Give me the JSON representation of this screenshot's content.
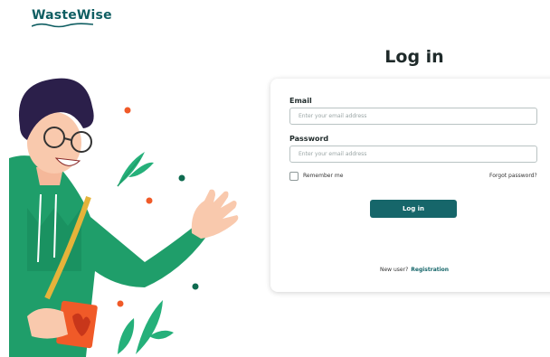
{
  "brand": {
    "name": "WasteWise"
  },
  "page": {
    "title": "Log in"
  },
  "form": {
    "email_label": "Email",
    "email_placeholder": "Enter your email address",
    "password_label": "Password",
    "password_placeholder": "Enter your email address",
    "remember_label": "Remember me",
    "forgot_label": "Forgot password?",
    "submit_label": "Log in",
    "new_user_text": "New user?",
    "register_label": "Registration"
  },
  "colors": {
    "brand": "#0f5e62",
    "button": "#16666a",
    "accent_orange": "#f05a28",
    "accent_green": "#1f9e6a"
  },
  "illustration": {
    "name": "waving-man-illustration"
  }
}
